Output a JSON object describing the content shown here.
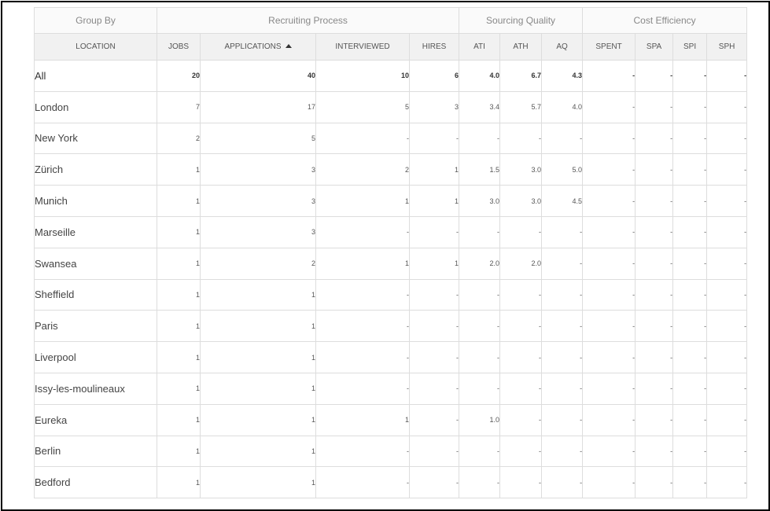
{
  "groups": {
    "group_by": "Group By",
    "recruiting": "Recruiting Process",
    "sourcing": "Sourcing Quality",
    "cost": "Cost Efficiency"
  },
  "columns": {
    "location": "LOCATION",
    "jobs": "JOBS",
    "applications": "APPLICATIONS",
    "interviewed": "INTERVIEWED",
    "hires": "HIRES",
    "ati": "ATI",
    "ath": "ATH",
    "aq": "AQ",
    "spent": "SPENT",
    "spa": "SPA",
    "spi": "SPI",
    "sph": "SPH"
  },
  "sort": {
    "column": "applications",
    "direction": "ascending",
    "icon": "sort-ascending-icon"
  },
  "rows": [
    {
      "location": "All",
      "jobs": "20",
      "applications": "40",
      "interviewed": "10",
      "hires": "6",
      "ati": "4.0",
      "ath": "6.7",
      "aq": "4.3",
      "spent": "-",
      "spa": "-",
      "spi": "-",
      "sph": "-"
    },
    {
      "location": "London",
      "jobs": "7",
      "applications": "17",
      "interviewed": "5",
      "hires": "3",
      "ati": "3.4",
      "ath": "5.7",
      "aq": "4.0",
      "spent": "-",
      "spa": "-",
      "spi": "-",
      "sph": "-"
    },
    {
      "location": "New York",
      "jobs": "2",
      "applications": "5",
      "interviewed": "-",
      "hires": "-",
      "ati": "-",
      "ath": "-",
      "aq": "-",
      "spent": "-",
      "spa": "-",
      "spi": "-",
      "sph": "-"
    },
    {
      "location": "Zürich",
      "jobs": "1",
      "applications": "3",
      "interviewed": "2",
      "hires": "1",
      "ati": "1.5",
      "ath": "3.0",
      "aq": "5.0",
      "spent": "-",
      "spa": "-",
      "spi": "-",
      "sph": "-"
    },
    {
      "location": "Munich",
      "jobs": "1",
      "applications": "3",
      "interviewed": "1",
      "hires": "1",
      "ati": "3.0",
      "ath": "3.0",
      "aq": "4.5",
      "spent": "-",
      "spa": "-",
      "spi": "-",
      "sph": "-"
    },
    {
      "location": "Marseille",
      "jobs": "1",
      "applications": "3",
      "interviewed": "-",
      "hires": "-",
      "ati": "-",
      "ath": "-",
      "aq": "-",
      "spent": "-",
      "spa": "-",
      "spi": "-",
      "sph": "-"
    },
    {
      "location": "Swansea",
      "jobs": "1",
      "applications": "2",
      "interviewed": "1",
      "hires": "1",
      "ati": "2.0",
      "ath": "2.0",
      "aq": "-",
      "spent": "-",
      "spa": "-",
      "spi": "-",
      "sph": "-"
    },
    {
      "location": "Sheffield",
      "jobs": "1",
      "applications": "1",
      "interviewed": "-",
      "hires": "-",
      "ati": "-",
      "ath": "-",
      "aq": "-",
      "spent": "-",
      "spa": "-",
      "spi": "-",
      "sph": "-"
    },
    {
      "location": "Paris",
      "jobs": "1",
      "applications": "1",
      "interviewed": "-",
      "hires": "-",
      "ati": "-",
      "ath": "-",
      "aq": "-",
      "spent": "-",
      "spa": "-",
      "spi": "-",
      "sph": "-"
    },
    {
      "location": "Liverpool",
      "jobs": "1",
      "applications": "1",
      "interviewed": "-",
      "hires": "-",
      "ati": "-",
      "ath": "-",
      "aq": "-",
      "spent": "-",
      "spa": "-",
      "spi": "-",
      "sph": "-"
    },
    {
      "location": "Issy-les-moulineaux",
      "jobs": "1",
      "applications": "1",
      "interviewed": "-",
      "hires": "-",
      "ati": "-",
      "ath": "-",
      "aq": "-",
      "spent": "-",
      "spa": "-",
      "spi": "-",
      "sph": "-"
    },
    {
      "location": "Eureka",
      "jobs": "1",
      "applications": "1",
      "interviewed": "1",
      "hires": "-",
      "ati": "1.0",
      "ath": "-",
      "aq": "-",
      "spent": "-",
      "spa": "-",
      "spi": "-",
      "sph": "-"
    },
    {
      "location": "Berlin",
      "jobs": "1",
      "applications": "1",
      "interviewed": "-",
      "hires": "-",
      "ati": "-",
      "ath": "-",
      "aq": "-",
      "spent": "-",
      "spa": "-",
      "spi": "-",
      "sph": "-"
    },
    {
      "location": "Bedford",
      "jobs": "1",
      "applications": "1",
      "interviewed": "-",
      "hires": "-",
      "ati": "-",
      "ath": "-",
      "aq": "-",
      "spent": "-",
      "spa": "-",
      "spi": "-",
      "sph": "-"
    }
  ],
  "colors": {
    "frame_border": "#000000",
    "header_group_bg": "#fafafa",
    "header_column_bg": "#f1f1f1",
    "grid_line": "#dddddd",
    "text": "#555555"
  }
}
